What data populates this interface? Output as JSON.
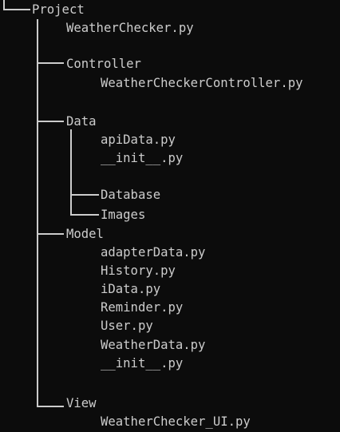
{
  "tree": {
    "root": "Project",
    "root_file": "WeatherChecker.py",
    "controller": {
      "folder": "Controller",
      "files": [
        "WeatherCheckerController.py"
      ]
    },
    "data": {
      "folder": "Data",
      "files": [
        "apiData.py",
        "__init__.py"
      ],
      "subfolders": [
        "Database",
        "Images"
      ]
    },
    "model": {
      "folder": "Model",
      "files": [
        "adapterData.py",
        "History.py",
        "iData.py",
        "Reminder.py",
        "User.py",
        "WeatherData.py",
        "__init__.py"
      ]
    },
    "view": {
      "folder": "View",
      "files": [
        "WeatherChecker_UI.py"
      ]
    }
  }
}
